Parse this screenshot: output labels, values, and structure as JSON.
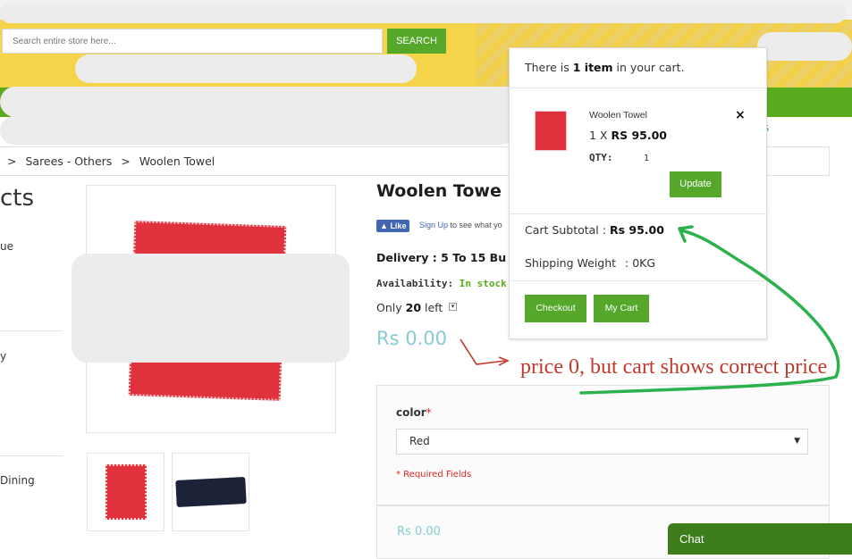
{
  "header": {
    "search_placeholder": "Search entire store here...",
    "search_button": "SEARCH"
  },
  "breadcrumb": {
    "items": [
      ">",
      "Sarees - Others",
      ">",
      "Woolen Towel"
    ]
  },
  "sidebar": {
    "title": "cts",
    "items": [
      "ue",
      "y",
      "Dining"
    ]
  },
  "product": {
    "title": "Woolen Towe",
    "fb_like": "Like",
    "fb_signup": "Sign Up",
    "fb_text": "to see what yo",
    "delivery": "Delivery : 5 To 15 Bu",
    "availability_label": "Availability:",
    "availability_value": "In stock",
    "only_prefix": "Only",
    "only_count": "20",
    "only_suffix": "left",
    "price": "Rs 0.00"
  },
  "options": {
    "color_label": "color",
    "required_star": "*",
    "color_selected": "Red",
    "required_note": "* Required Fields",
    "price": "Rs 0.00"
  },
  "cart": {
    "summary_prefix": "There is",
    "summary_count": "1 item",
    "summary_suffix": "in your cart.",
    "item_name": "Woolen Towel",
    "item_qty_prefix": "1 X",
    "item_price": "RS 95.00",
    "qty_label": "QTY:",
    "qty_value": "1",
    "remove_icon": "×",
    "update_button": "Update",
    "subtotal_label": "Cart Subtotal :",
    "subtotal_value": "Rs 95.00",
    "weight_label": "Shipping Weight",
    "weight_value": ": 0KG",
    "checkout_button": "Checkout",
    "mycart_button": "My Cart"
  },
  "nav_partial": "s",
  "chat_label": "Chat",
  "annotation_note": "price 0, but cart shows correct price",
  "colors": {
    "brand_green": "#55a82a",
    "price_teal": "#86ccd0",
    "annotation_red": "#c0392b",
    "annotation_green": "#2bb24c",
    "header_yellow": "#f6d44a"
  }
}
